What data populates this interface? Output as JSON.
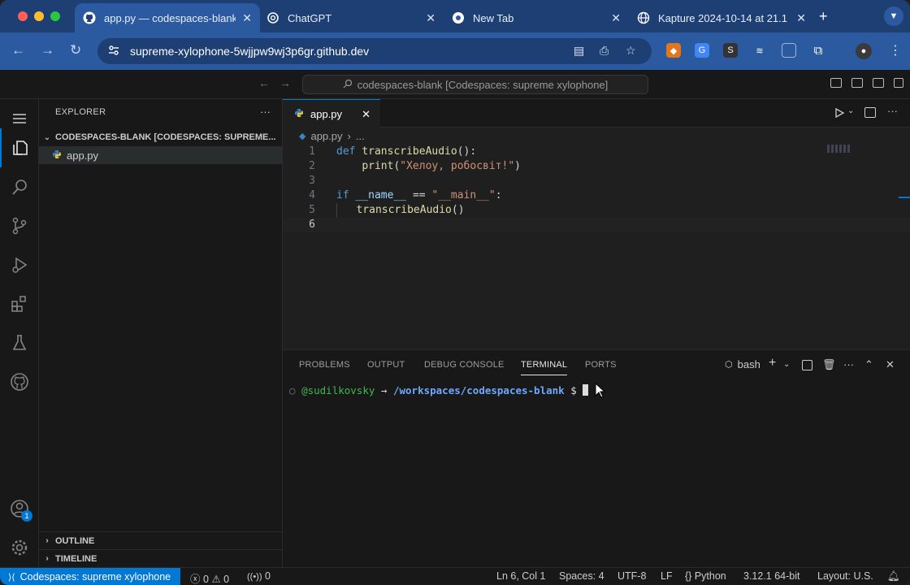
{
  "browser": {
    "tabs": [
      {
        "title": "app.py — codespaces-blank",
        "icon": "github-icon"
      },
      {
        "title": "ChatGPT",
        "icon": "chatgpt-icon"
      },
      {
        "title": "New Tab",
        "icon": "chrome-icon"
      },
      {
        "title": "Kapture 2024-10-14 at 21.1",
        "icon": "globe-icon"
      }
    ],
    "url": "supreme-xylophone-5wjjpw9wj3p6gr.github.dev"
  },
  "vscode": {
    "command_center": "codespaces-blank [Codespaces: supreme xylophone]",
    "sidebar": {
      "title": "EXPLORER",
      "root": "CODESPACES-BLANK [CODESPACES: SUPREME...",
      "files": [
        "app.py"
      ],
      "outline": "OUTLINE",
      "timeline": "TIMELINE"
    },
    "accounts_badge": "1",
    "editor": {
      "tab": "app.py",
      "breadcrumb": [
        "app.py",
        "..."
      ],
      "line_numbers": [
        "1",
        "2",
        "3",
        "4",
        "5",
        "6"
      ]
    },
    "panel": {
      "tabs": [
        "PROBLEMS",
        "OUTPUT",
        "DEBUG CONSOLE",
        "TERMINAL",
        "PORTS"
      ],
      "shell": "bash",
      "prompt_user": "@sudilkovsky",
      "prompt_arrow": "→",
      "prompt_path": "/workspaces/codespaces-blank",
      "prompt_symbol": "$"
    },
    "status": {
      "remote": "Codespaces: supreme xylophone",
      "errors": "0",
      "warnings": "0",
      "ports": "0",
      "position": "Ln 6, Col 1",
      "spaces": "Spaces: 4",
      "encoding": "UTF-8",
      "eol": "LF",
      "language": "Python",
      "interpreter": "3.12.1 64-bit",
      "layout": "Layout: U.S."
    }
  },
  "code": {
    "l1_def": "def",
    "l1_name": "transcribeAudio",
    "l1_rest": "():",
    "l2_print": "print",
    "l2_open": "(",
    "l2_str": "\"Хелоу, робосвіт!\"",
    "l2_close": ")",
    "l4_if": "if",
    "l4_name": "__name__",
    "l4_eq": "==",
    "l4_str": "\"__main__\"",
    "l4_colon": ":",
    "l5_call": "transcribeAudio",
    "l5_paren": "()"
  },
  "colors": {
    "accent": "#0078d4",
    "chrome_bg": "#1e3f74",
    "chrome_active": "#2c5aa0"
  }
}
